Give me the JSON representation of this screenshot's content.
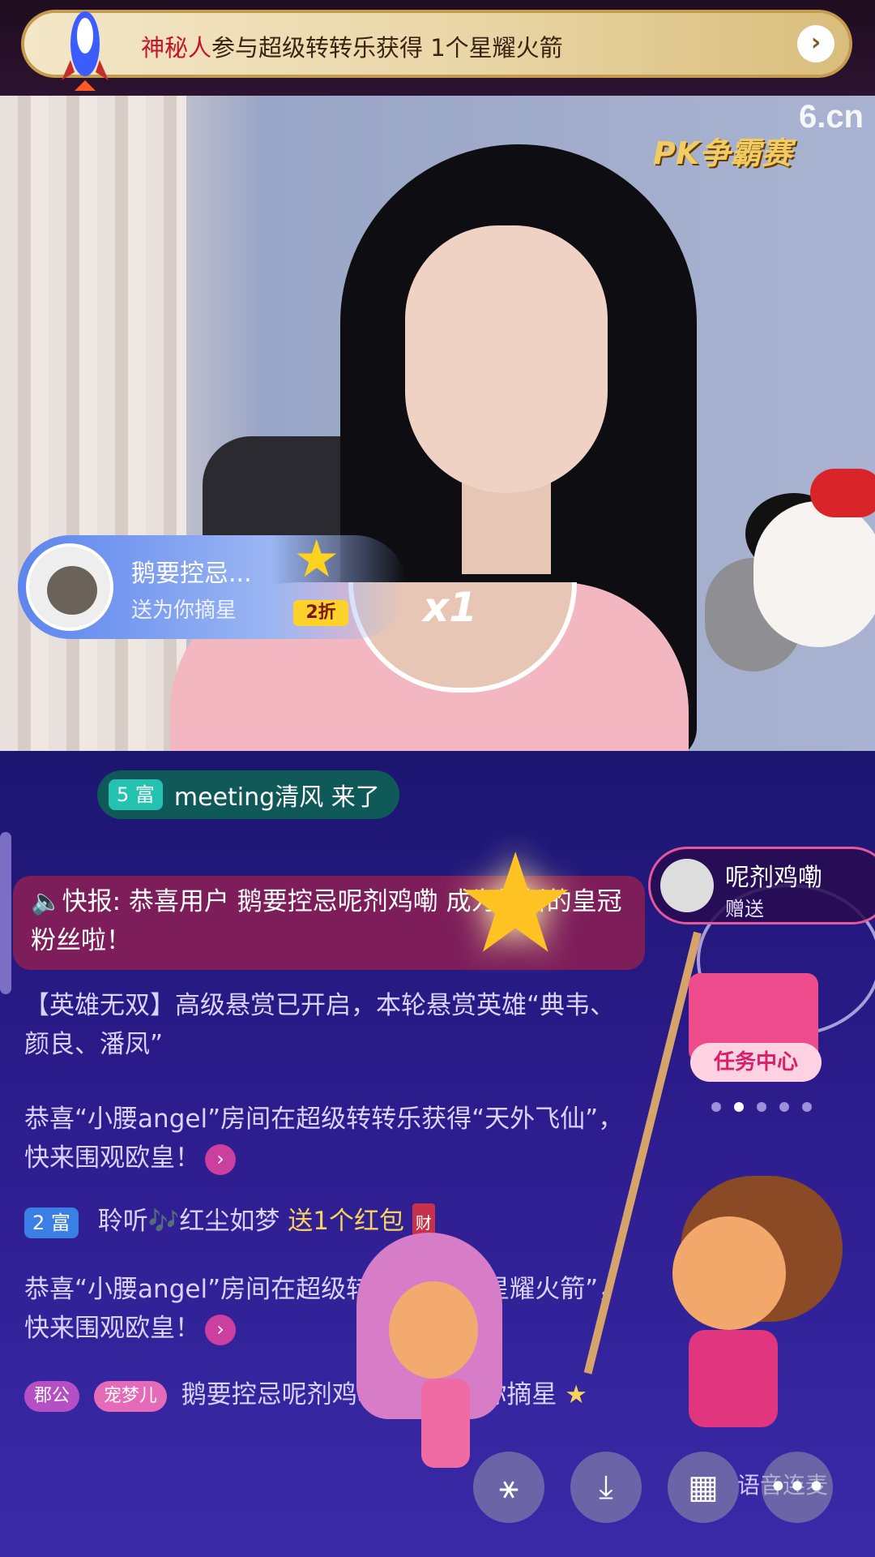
{
  "banner": {
    "who": "神秘人",
    "rest": "参与超级转转乐获得 1个星耀火箭",
    "arrow": "›"
  },
  "video": {
    "watermark": "6.cn",
    "pk_logo": "PK争霸赛"
  },
  "gift_card": {
    "name": "鹅要控忌...",
    "sub": "送为你摘星",
    "discount": "2折",
    "combo": "x1"
  },
  "chat": {
    "join": {
      "level": "5 富",
      "text": "meeting清风 来了"
    },
    "flash": "🔈快报: 恭喜用户 鹅要控忌呢剂鸡嘞 成为最新的皇冠粉丝啦！",
    "bounty": "【英雄无双】高级悬赏已开启，本轮悬赏英雄“典韦、颜良、潘凤”",
    "congrats1": "恭喜“小腰angel”房间在超级转转乐获得“天外飞仙”，快来围观欧皇！",
    "redpacket": {
      "level": "2 富",
      "user": "聆听🎶红尘如梦",
      "action": "送1个红包",
      "tag": "财"
    },
    "congrats2": "恭喜“小腰angel”房间在超级转转乐获得“星耀火箭”，快来围观欧皇！",
    "gift_line": {
      "badge1": "郡公",
      "badge2": "宠梦儿",
      "text": "鹅要控忌呢剂鸡嘞 送1个为你摘星"
    }
  },
  "sender": {
    "name": "呢剂鸡嘞",
    "sub": "赠送"
  },
  "task_center": {
    "label": "任务中心"
  },
  "toolbar": {
    "btn1": "⚹",
    "btn2": "⤓",
    "btn3": "▦",
    "btn4": "•••",
    "voice": "语音连麦"
  },
  "colors": {
    "accent_pink": "#e5579d",
    "gold": "#f6d35e",
    "chat_bg": "#2b1b8a"
  }
}
